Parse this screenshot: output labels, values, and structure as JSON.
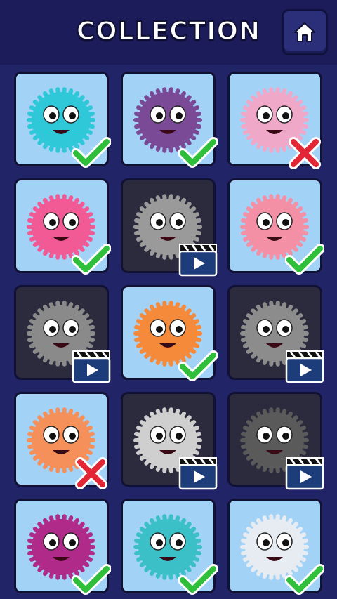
{
  "header": {
    "title": "COLLECTION",
    "home_icon": "home-icon"
  },
  "colors": {
    "background": "#222468",
    "header": "#1c1c5a",
    "unlocked_card": "#a3d2f7",
    "locked_card": "#2b2b3d",
    "check": "#2fbf3a",
    "cross": "#e32636",
    "video": "#1d3d7a"
  },
  "items": [
    {
      "color": "#2ec8d8",
      "status": "collected"
    },
    {
      "color": "#7a4a96",
      "status": "collected"
    },
    {
      "color": "#f0a8c8",
      "status": "missing"
    },
    {
      "color": "#f25a96",
      "status": "collected"
    },
    {
      "color": "#9a9a9a",
      "status": "video"
    },
    {
      "color": "#f490a6",
      "status": "collected"
    },
    {
      "color": "#8a8a8a",
      "status": "video"
    },
    {
      "color": "#f58a3a",
      "status": "collected"
    },
    {
      "color": "#8c8c8c",
      "status": "video"
    },
    {
      "color": "#f5905a",
      "status": "missing"
    },
    {
      "color": "#cfcfcf",
      "status": "video"
    },
    {
      "color": "#5a5a5a",
      "status": "video"
    },
    {
      "color": "#b02a8a",
      "status": "collected"
    },
    {
      "color": "#3cc0c8",
      "status": "collected"
    },
    {
      "color": "#e6ecf2",
      "status": "collected"
    }
  ]
}
